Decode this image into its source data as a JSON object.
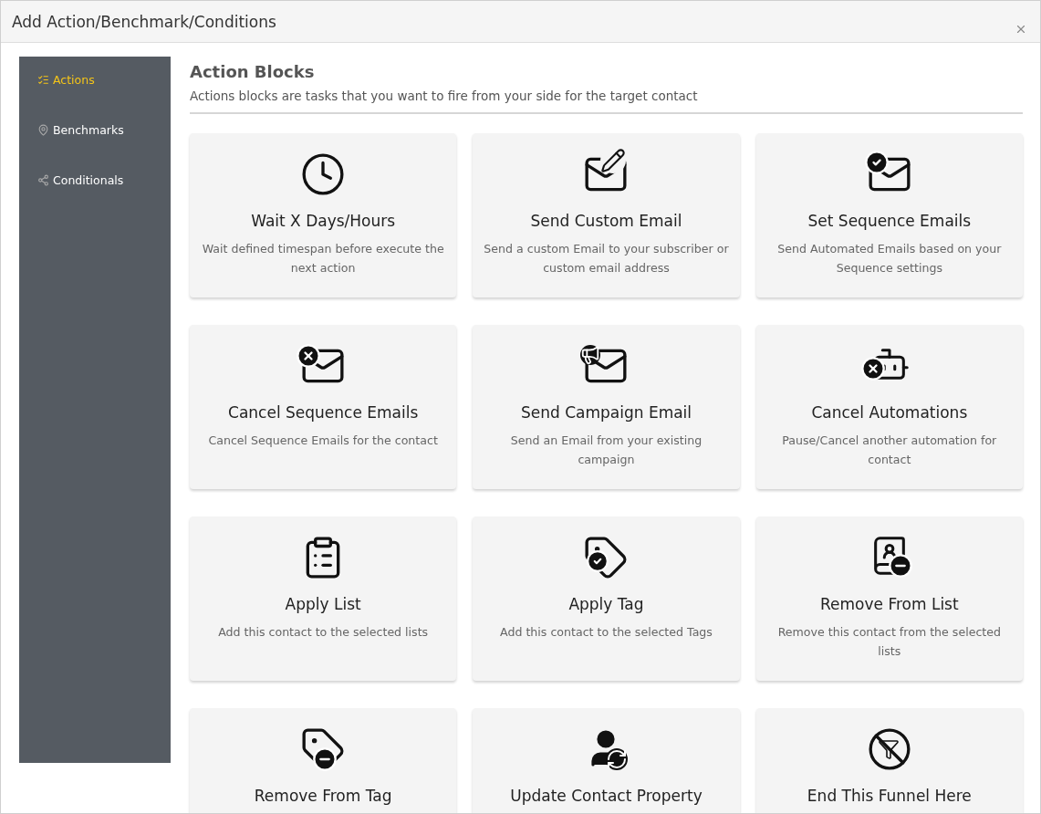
{
  "window": {
    "title": "Add Action/Benchmark/Conditions"
  },
  "sidebar": {
    "items": [
      {
        "label": "Actions",
        "selected": true
      },
      {
        "label": "Benchmarks",
        "selected": false
      },
      {
        "label": "Conditionals",
        "selected": false
      }
    ]
  },
  "section": {
    "title": "Action Blocks",
    "subtitle": "Actions blocks are tasks that you want to fire from your side for the target contact"
  },
  "cards": [
    {
      "title": "Wait X Days/Hours",
      "description": "Wait defined timespan before execute the next action"
    },
    {
      "title": "Send Custom Email",
      "description": "Send a custom Email to your subscriber or custom email address"
    },
    {
      "title": "Set Sequence Emails",
      "description": "Send Automated Emails based on your Sequence settings"
    },
    {
      "title": "Cancel Sequence Emails",
      "description": "Cancel Sequence Emails for the contact"
    },
    {
      "title": "Send Campaign Email",
      "description": "Send an Email from your existing campaign"
    },
    {
      "title": "Cancel Automations",
      "description": "Pause/Cancel another automation for contact"
    },
    {
      "title": "Apply List",
      "description": "Add this contact to the selected lists"
    },
    {
      "title": "Apply Tag",
      "description": "Add this contact to the selected Tags"
    },
    {
      "title": "Remove From List",
      "description": "Remove this contact from the selected lists"
    },
    {
      "title": "Remove From Tag"
    },
    {
      "title": "Update Contact Property"
    },
    {
      "title": "End This Funnel Here"
    }
  ]
}
